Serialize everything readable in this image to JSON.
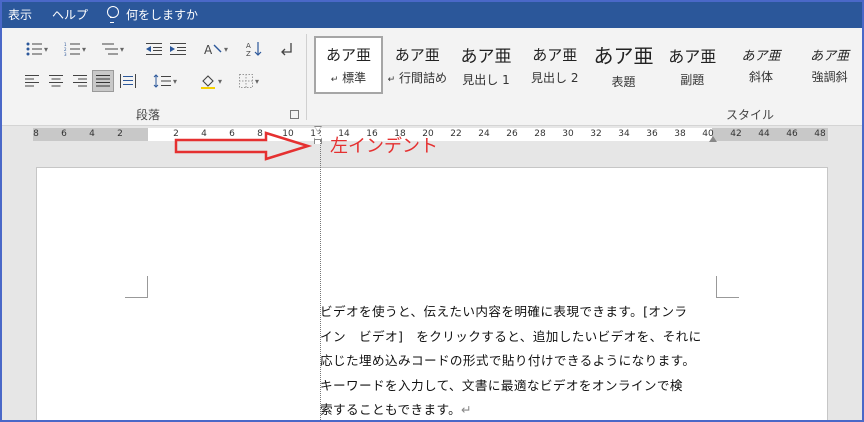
{
  "menubar": {
    "items": [
      "表示",
      "ヘルプ"
    ],
    "tell_me": "何をしますか"
  },
  "ribbon": {
    "paragraph_group_label": "段落",
    "styles_group_label": "スタイル",
    "styles": [
      {
        "preview": "あア亜",
        "name": "標準",
        "mark": "↵",
        "selected": true
      },
      {
        "preview": "あア亜",
        "name": "行間詰め",
        "mark": "↵",
        "selected": false
      },
      {
        "preview": "あア亜",
        "name": "見出し 1",
        "mark": "",
        "selected": false
      },
      {
        "preview": "あア亜",
        "name": "見出し 2",
        "mark": "",
        "selected": false
      },
      {
        "preview": "あア亜",
        "name": "表題",
        "mark": "",
        "selected": false
      },
      {
        "preview": "あア亜",
        "name": "副題",
        "mark": "",
        "selected": false
      },
      {
        "preview": "あア亜",
        "name": "斜体",
        "mark": "",
        "selected": false
      },
      {
        "preview": "あア亜",
        "name": "強調斜",
        "mark": "",
        "selected": false
      }
    ]
  },
  "ruler": {
    "left_numbers": [
      "8",
      "6",
      "4",
      "2"
    ],
    "right_numbers": [
      "2",
      "4",
      "6",
      "8",
      "10",
      "12",
      "14",
      "16",
      "18",
      "20",
      "22",
      "24",
      "26",
      "28",
      "30",
      "32",
      "34",
      "36",
      "38",
      "40",
      "42",
      "44",
      "46",
      "48"
    ]
  },
  "annotation": {
    "label": "左インデント",
    "color": "#e53030"
  },
  "document": {
    "lines": [
      "ビデオを使うと、伝えたい内容を明確に表現できます。[オンラ",
      "イン　ビデオ]　をクリックすると、追加したいビデオを、それに",
      "応じた埋め込みコードの形式で貼り付けできるようになります。",
      "キーワードを入力して、文書に最適なビデオをオンラインで検",
      "索することもできます。"
    ],
    "paragraph_mark": "↵"
  },
  "colors": {
    "titlebar": "#2b579a",
    "frame": "#4a68c8"
  }
}
